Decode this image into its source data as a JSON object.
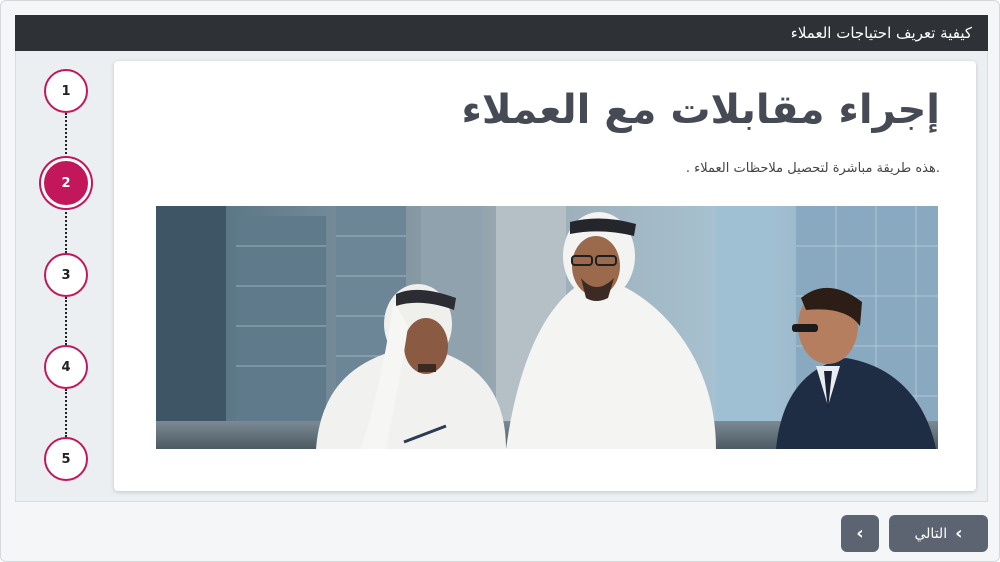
{
  "header": {
    "title": "كيفية تعريف احتياجات العملاء"
  },
  "stepper": {
    "steps": [
      "1",
      "2",
      "3",
      "4",
      "5"
    ],
    "active_step": 2,
    "accent_color": "#c2185b"
  },
  "card": {
    "title": "إجراء مقابلات مع العملاء",
    "description": ".هذه طريقة مباشرة لتحصيل ملاحظات العملاء ."
  },
  "nav": {
    "next_label": "التالي",
    "prev_icon": "chevron-right-icon",
    "next_icon": "chevron-left-icon"
  }
}
